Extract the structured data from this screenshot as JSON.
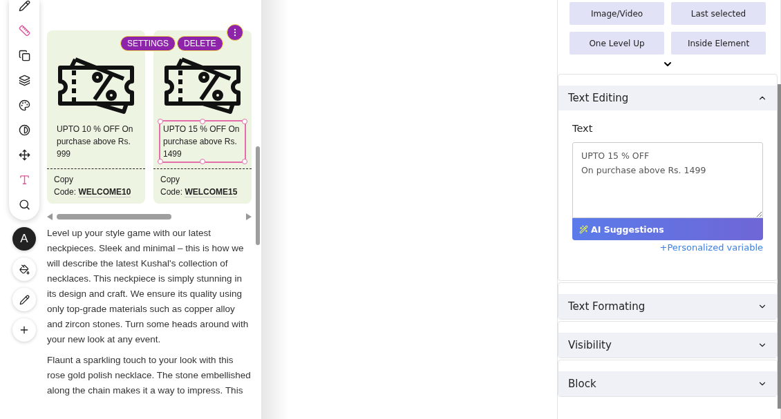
{
  "toolbar": {
    "avatar": "A"
  },
  "element_actions": [
    "SETTINGS",
    "DELETE"
  ],
  "coupons": [
    {
      "offer": "UPTO 10 % OFF On purchase above Rs. 999",
      "copy_label": "Copy",
      "code_label": "Code:",
      "code": "WELCOME10",
      "selected": false
    },
    {
      "offer": "UPTO 15 % OFF On purchase above Rs. 1499",
      "copy_label": "Copy",
      "code_label": "Code:",
      "code": "WELCOME15",
      "selected": true
    }
  ],
  "paragraphs": [
    "Level up your style game with our latest neckpieces. Sleek and minimal – this is how we will describe the latest Kushal's collection of necklaces. This neckpiece is simply stunning in its design and craft. We ensure its quality using only top-grade materials such as copper alloy and zircon stones. Turn some heads around with your new look at any event.",
    "Flaunt a sparkling touch to your look with this rose gold polish necklace. The stone embellished along the chain makes it a way to impress. This"
  ],
  "select_buttons": [
    "Image/Video",
    "Last selected",
    "One Level Up",
    "Inside Element"
  ],
  "sections": [
    {
      "title": "Text Editing",
      "expanded": true,
      "field_label": "Text",
      "value": "UPTO 15 % OFF\nOn purchase above Rs. 1499",
      "ai_button": "AI Suggestions",
      "link": "+Personalized variable"
    },
    {
      "title": "Text Formating",
      "expanded": false
    },
    {
      "title": "Visibility",
      "expanded": false
    },
    {
      "title": "Block",
      "expanded": false
    }
  ]
}
